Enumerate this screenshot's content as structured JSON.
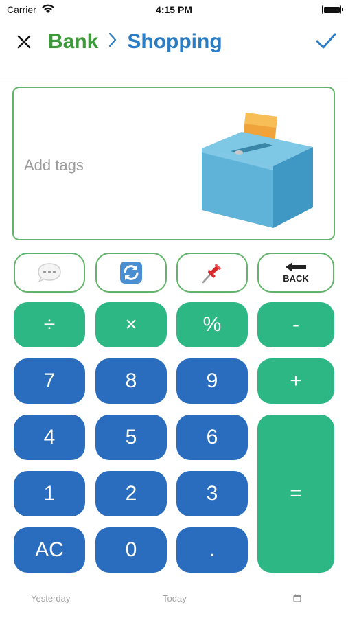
{
  "status": {
    "carrier": "Carrier",
    "time": "4:15 PM"
  },
  "nav": {
    "from": "Bank",
    "separator": "›",
    "to": "Shopping"
  },
  "tags": {
    "placeholder": "Add tags"
  },
  "tools": {
    "back_label": "BACK"
  },
  "keys": {
    "divide": "÷",
    "multiply": "×",
    "percent": "%",
    "minus": "-",
    "seven": "7",
    "eight": "8",
    "nine": "9",
    "plus": "+",
    "four": "4",
    "five": "5",
    "six": "6",
    "equals": "=",
    "one": "1",
    "two": "2",
    "three": "3",
    "clear": "AC",
    "zero": "0",
    "dot": "."
  },
  "dates": {
    "yesterday": "Yesterday",
    "today": "Today"
  },
  "colors": {
    "brand_green": "#3d9c3a",
    "brand_blue": "#2c7cc4",
    "key_green": "#2db784",
    "key_blue": "#2a6dbe"
  }
}
